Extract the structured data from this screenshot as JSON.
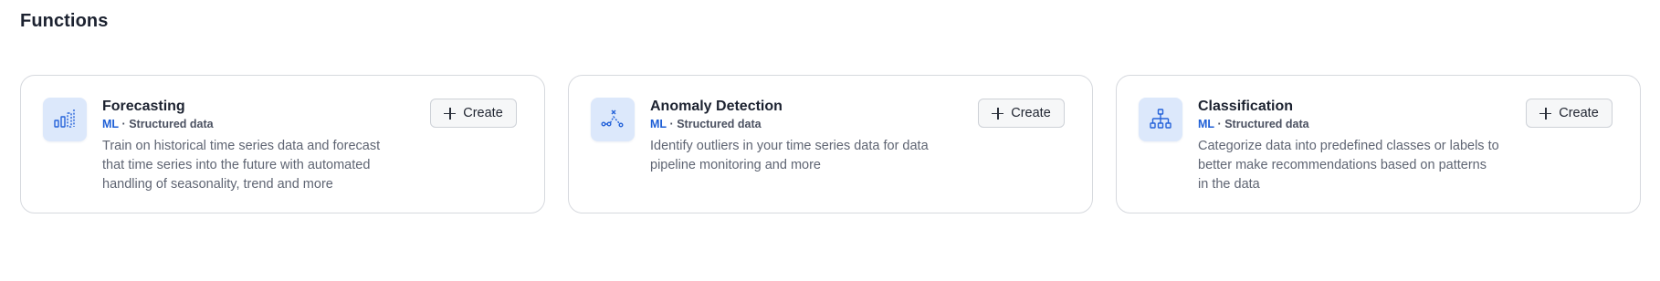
{
  "page": {
    "title": "Functions"
  },
  "cards": [
    {
      "title": "Forecasting",
      "tag": "ML",
      "separator": "·",
      "kind": "Structured data",
      "description": "Train on historical time series data and forecast that time series into the future with automated handling of seasonality, trend and more",
      "icon": "forecasting-chart-icon",
      "create_label": "Create"
    },
    {
      "title": "Anomaly Detection",
      "tag": "ML",
      "separator": "·",
      "kind": "Structured data",
      "description": "Identify outliers in your time series data for data pipeline monitoring and more",
      "icon": "anomaly-detection-icon",
      "create_label": "Create"
    },
    {
      "title": "Classification",
      "tag": "ML",
      "separator": "·",
      "kind": "Structured data",
      "description": "Categorize data into predefined classes or labels to better make recommendations based on patterns in the data",
      "icon": "classification-tree-icon",
      "create_label": "Create"
    }
  ],
  "colors": {
    "accent": "#1f5fd6",
    "icon_background": "#dce8fb",
    "card_border": "#d6d9de"
  }
}
